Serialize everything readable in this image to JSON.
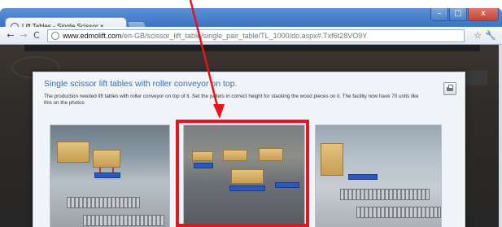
{
  "browser": {
    "tab_title": "Lift Tables - Single Scissor ×",
    "tab_close": "×",
    "window_buttons": {
      "minimize": "–",
      "maximize": "□",
      "close": "x"
    },
    "nav": {
      "back": "←",
      "forward": "→",
      "reload": "C"
    },
    "url_host": "www.edmolift.com",
    "url_path": "/en-GB/scissor_lift_table/single_pair_table/TL_1000/do.aspx#.Txf6t28VO9Y",
    "icons": {
      "star": "☆",
      "wrench": "🔧"
    }
  },
  "lightbox": {
    "title": "Single scissor lift tables with roller conveyor on top.",
    "description": "The production needed lift tables with roller conveyor on top of it. Set the pallets in correct height for stacking the wood pieces on it. The facility now have 70 units like this on the photos"
  },
  "colors": {
    "highlight": "#e8141b",
    "title_blue": "#3a6db0",
    "chrome_blue": "#3f77c8"
  }
}
